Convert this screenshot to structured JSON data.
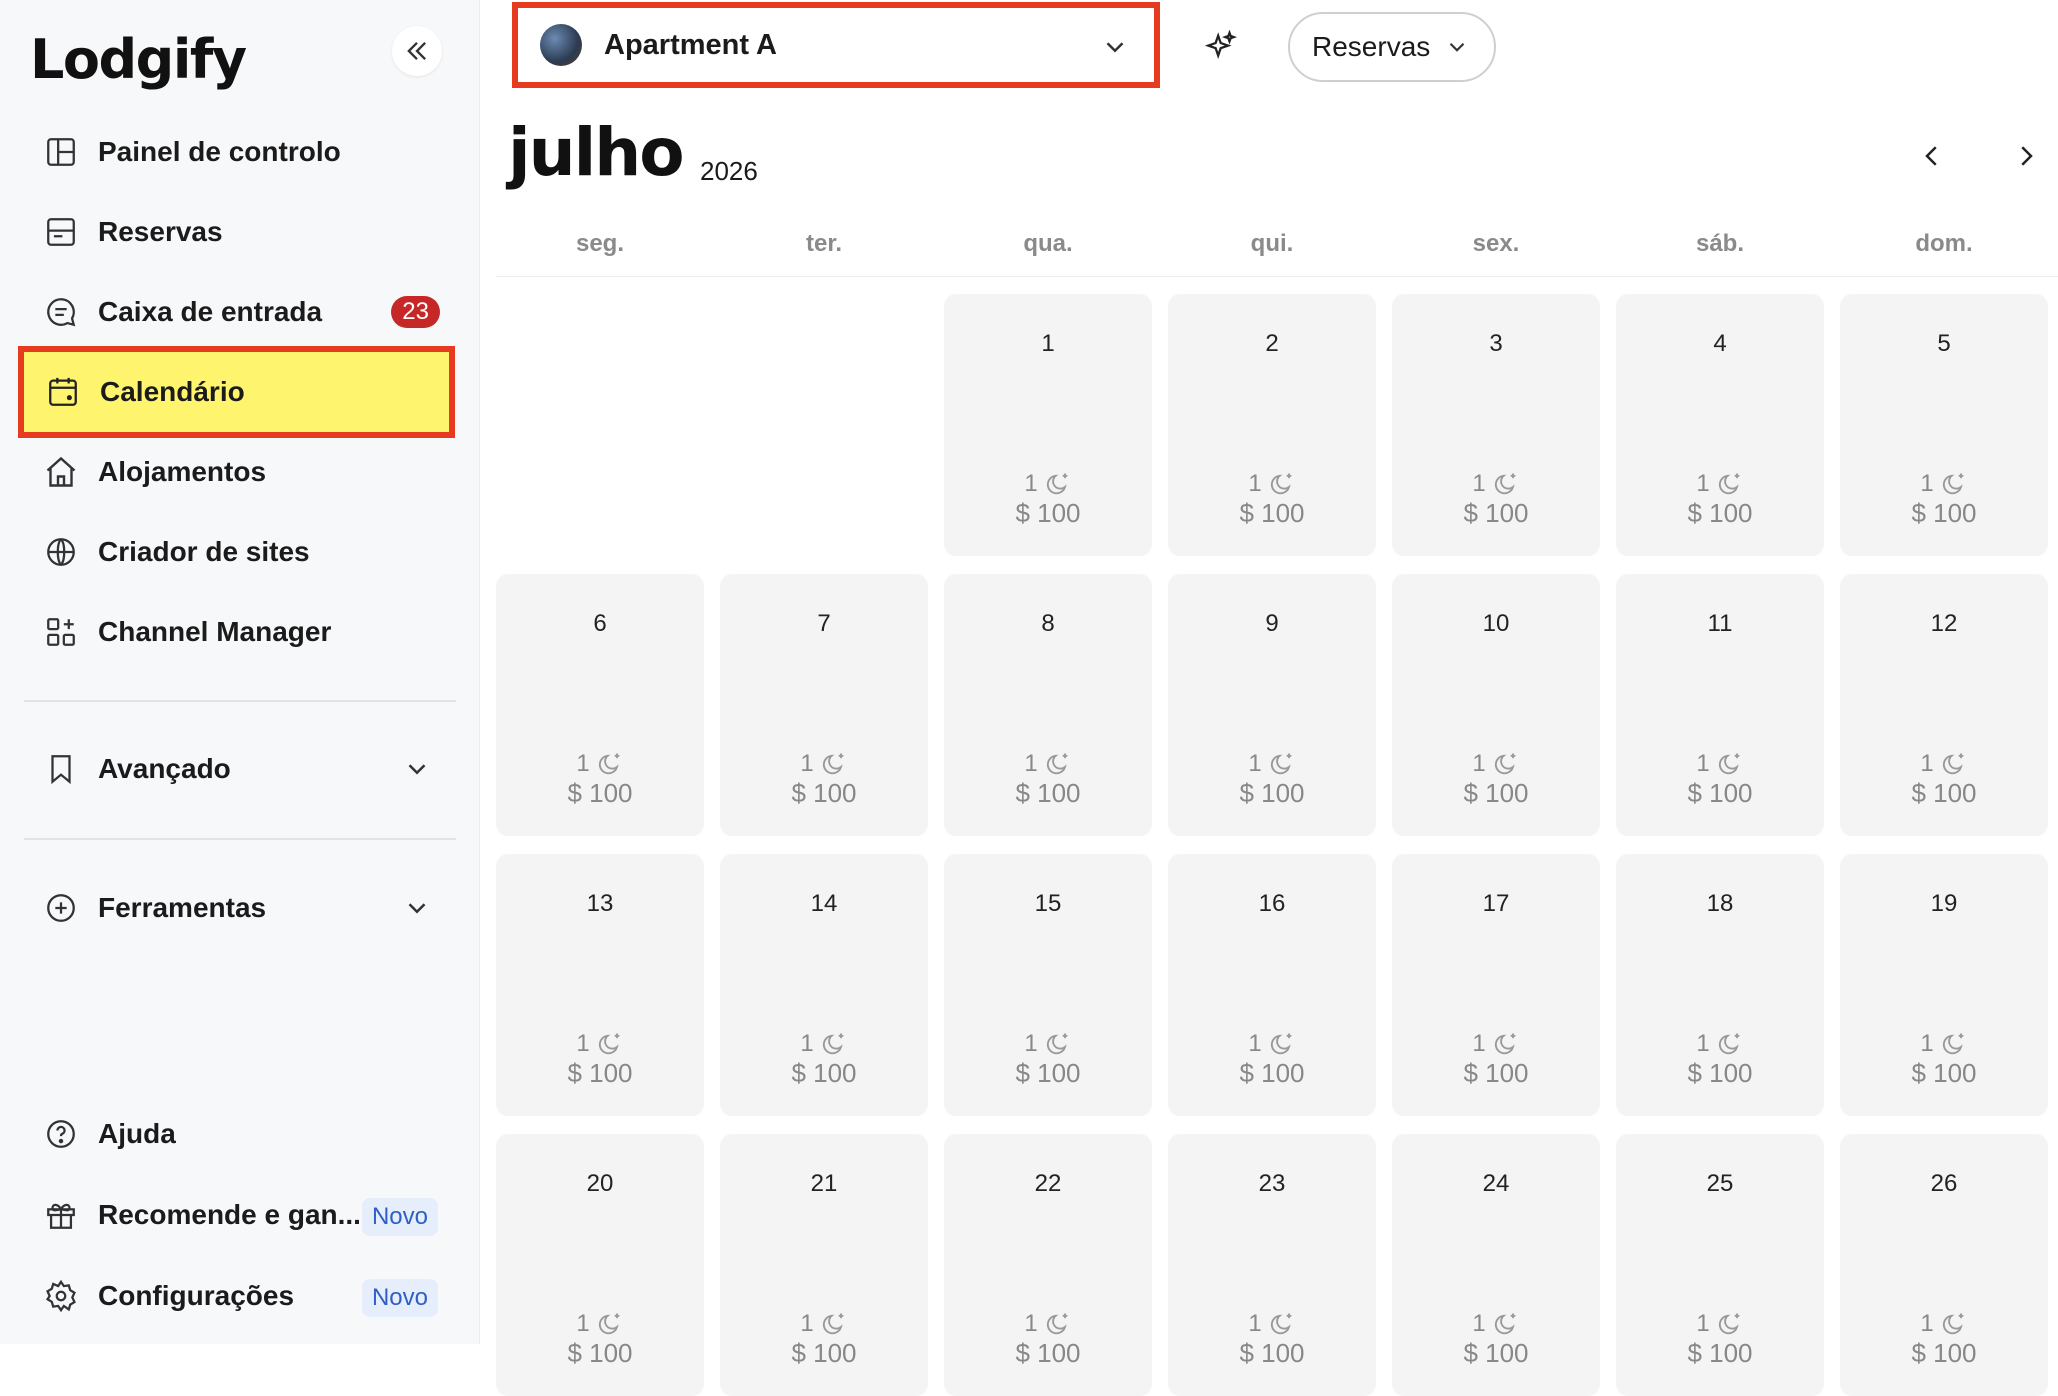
{
  "app": {
    "logo": "Lodgify"
  },
  "sidebar": {
    "items": [
      {
        "label": "Painel de controlo",
        "icon": "dashboard-icon"
      },
      {
        "label": "Reservas",
        "icon": "reservations-icon"
      },
      {
        "label": "Caixa de entrada",
        "icon": "inbox-icon",
        "badge": "23"
      },
      {
        "label": "Calendário",
        "icon": "calendar-icon",
        "active": true
      },
      {
        "label": "Alojamentos",
        "icon": "home-icon"
      },
      {
        "label": "Criador de sites",
        "icon": "globe-icon"
      },
      {
        "label": "Channel Manager",
        "icon": "channels-icon"
      },
      {
        "label": "Avançado",
        "icon": "bookmark-icon"
      },
      {
        "label": "Ferramentas",
        "icon": "plus-circle-icon"
      },
      {
        "label": "Ajuda",
        "icon": "help-icon"
      },
      {
        "label": "Recomende e gan...",
        "icon": "gift-icon",
        "tag": "Novo"
      },
      {
        "label": "Configurações",
        "icon": "settings-icon",
        "tag": "Novo"
      }
    ]
  },
  "header": {
    "property": "Apartment A",
    "view_button": "Reservas"
  },
  "calendar": {
    "month": "julho",
    "year": "2026",
    "weekdays": [
      "seg.",
      "ter.",
      "qua.",
      "qui.",
      "sex.",
      "sáb.",
      "dom."
    ],
    "min_nights": "1",
    "price": "$ 100",
    "days": [
      "1",
      "2",
      "3",
      "4",
      "5",
      "6",
      "7",
      "8",
      "9",
      "10",
      "11",
      "12",
      "13",
      "14",
      "15",
      "16",
      "17",
      "18",
      "19",
      "20",
      "21",
      "22",
      "23",
      "24",
      "25",
      "26"
    ]
  },
  "colors": {
    "highlight": "#fff46e",
    "outline": "#e63b1f",
    "badge": "#c62828",
    "novo_tag": "#2f5fc6"
  }
}
